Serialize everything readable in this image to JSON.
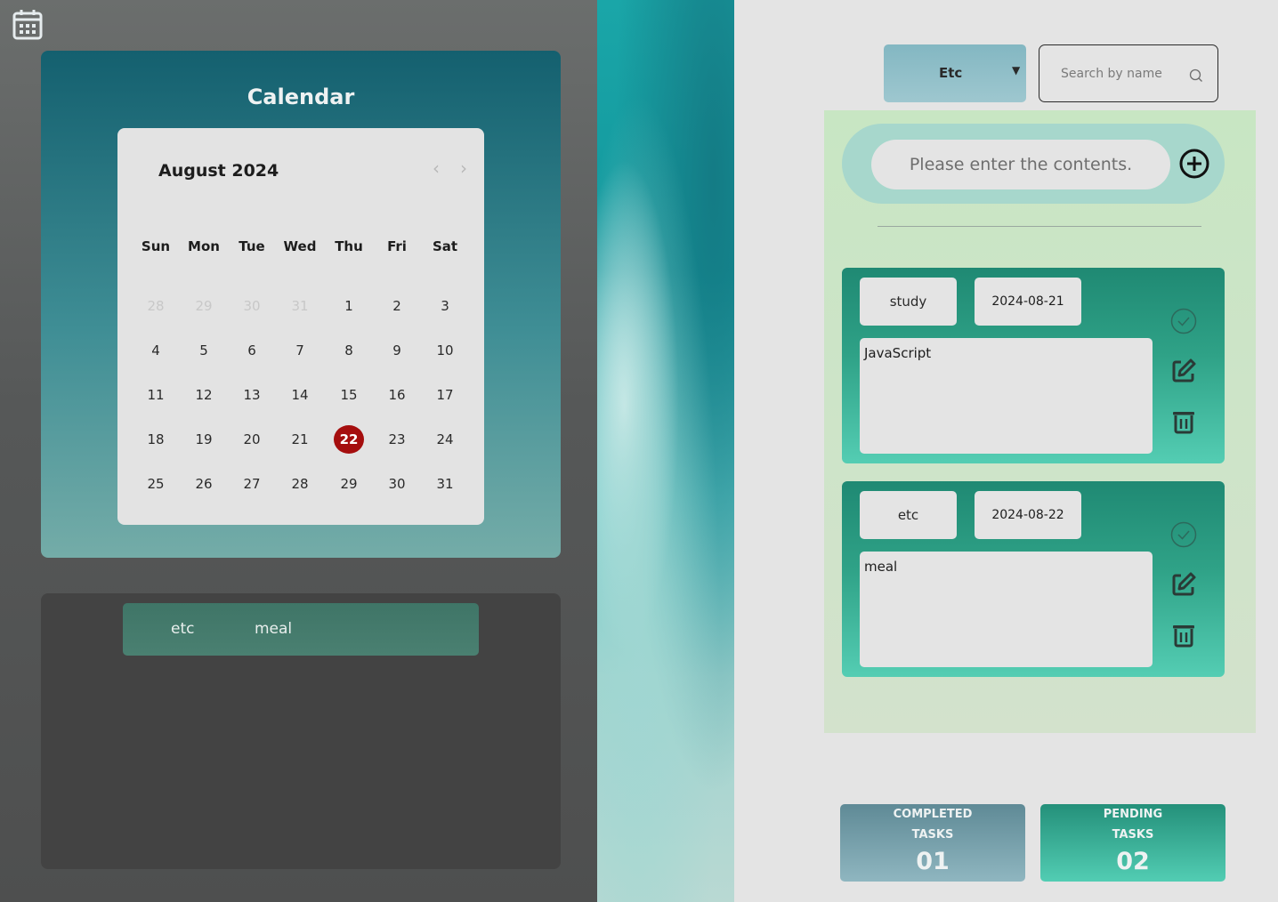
{
  "calendar": {
    "title": "Calendar",
    "month_label": "August 2024",
    "prev_label": "‹",
    "next_label": "›",
    "weekdays": [
      "Sun",
      "Mon",
      "Tue",
      "Wed",
      "Thu",
      "Fri",
      "Sat"
    ],
    "weeks": [
      [
        {
          "d": "28",
          "muted": true
        },
        {
          "d": "29",
          "muted": true
        },
        {
          "d": "30",
          "muted": true
        },
        {
          "d": "31",
          "muted": true
        },
        {
          "d": "1"
        },
        {
          "d": "2"
        },
        {
          "d": "3"
        }
      ],
      [
        {
          "d": "4"
        },
        {
          "d": "5"
        },
        {
          "d": "6"
        },
        {
          "d": "7"
        },
        {
          "d": "8"
        },
        {
          "d": "9"
        },
        {
          "d": "10"
        }
      ],
      [
        {
          "d": "11"
        },
        {
          "d": "12"
        },
        {
          "d": "13"
        },
        {
          "d": "14"
        },
        {
          "d": "15"
        },
        {
          "d": "16"
        },
        {
          "d": "17"
        }
      ],
      [
        {
          "d": "18"
        },
        {
          "d": "19"
        },
        {
          "d": "20"
        },
        {
          "d": "21"
        },
        {
          "d": "22",
          "today": true
        },
        {
          "d": "23"
        },
        {
          "d": "24"
        }
      ],
      [
        {
          "d": "25"
        },
        {
          "d": "26"
        },
        {
          "d": "27"
        },
        {
          "d": "28"
        },
        {
          "d": "29"
        },
        {
          "d": "30"
        },
        {
          "d": "31"
        }
      ]
    ],
    "today_color": "#a50e0e"
  },
  "events": [
    {
      "category": "etc",
      "text": "meal"
    }
  ],
  "filter": {
    "category_selected": "Etc",
    "search_placeholder": "Search by name"
  },
  "todo": {
    "input_placeholder": "Please enter the contents.",
    "items": [
      {
        "category": "study",
        "date": "2024-08-21",
        "content": "JavaScript"
      },
      {
        "category": "etc",
        "date": "2024-08-22",
        "content": "meal"
      }
    ]
  },
  "stats": {
    "completed_line1": "COMPLETED",
    "completed_line2": "TASKS",
    "completed_value": "01",
    "pending_line1": "PENDING",
    "pending_line2": "TASKS",
    "pending_value": "02"
  },
  "icons": {
    "calendar": "calendar-icon",
    "search": "search-icon",
    "add": "plus-circle-icon",
    "check": "check-circle-icon",
    "edit": "edit-icon",
    "delete": "trash-icon"
  },
  "colors": {
    "accent_teal": "#1f8973",
    "panel_dark": "#434343",
    "todo_background": "#c8e6c3"
  }
}
